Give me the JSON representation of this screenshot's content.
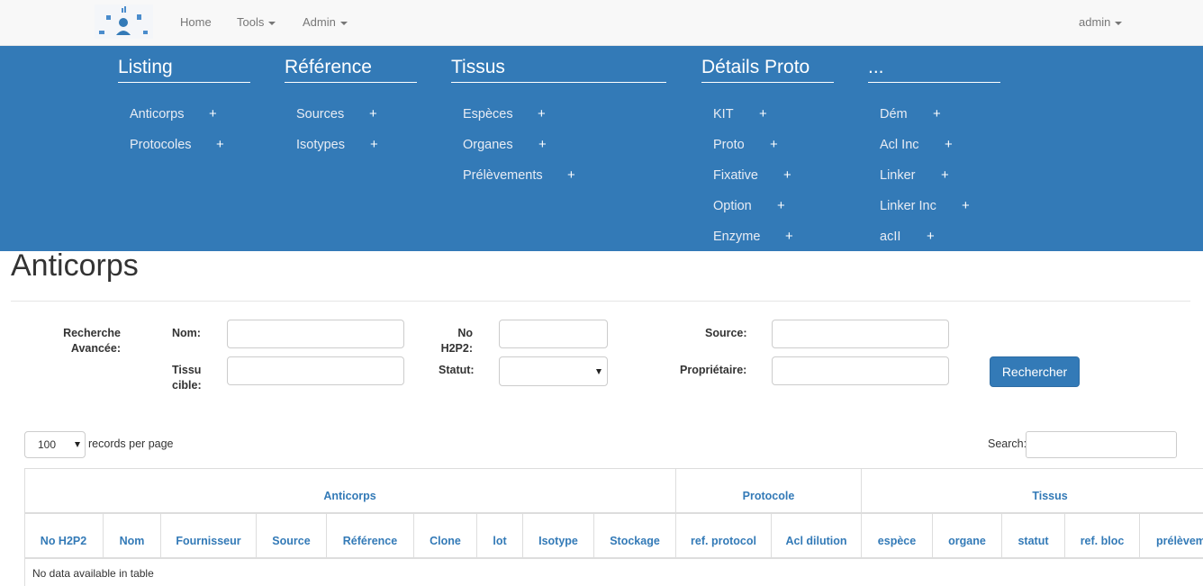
{
  "navbar": {
    "home": "Home",
    "tools": "Tools",
    "admin": "Admin",
    "user": "admin"
  },
  "menu": {
    "listing": {
      "title": "Listing",
      "items": [
        "Anticorps",
        "Protocoles"
      ]
    },
    "reference": {
      "title": "Référence",
      "items": [
        "Sources",
        "Isotypes"
      ]
    },
    "tissus": {
      "title": "Tissus",
      "items": [
        "Espèces",
        "Organes",
        "Prélèvements"
      ]
    },
    "details": {
      "title": "Détails Proto",
      "items": [
        "KIT",
        "Proto",
        "Fixative",
        "Option",
        "Enzyme"
      ]
    },
    "more": {
      "title": "...",
      "items": [
        "Dém",
        "Acl Inc",
        "Linker",
        "Linker Inc",
        "acII"
      ]
    },
    "plus": "+"
  },
  "page": {
    "title": "Anticorps"
  },
  "search_form": {
    "advanced_line1": "Recherche",
    "advanced_line2": "Avancée:",
    "nom": "Nom:",
    "no_line1": "No",
    "no_line2": "H2P2:",
    "source": "Source:",
    "tissu_line1": "Tissu",
    "tissu_line2": "cible:",
    "statut": "Statut:",
    "proprietaire": "Propriétaire:",
    "submit": "Rechercher"
  },
  "table_controls": {
    "page_length": "100",
    "records_per_page": "records per page",
    "search_label": "Search:"
  },
  "table": {
    "groups": [
      "Anticorps",
      "Protocole",
      "Tissus"
    ],
    "columns": [
      "No H2P2",
      "Nom",
      "Fournisseur",
      "Source",
      "Référence",
      "Clone",
      "lot",
      "Isotype",
      "Stockage",
      "ref. protocol",
      "Acl dilution",
      "espèce",
      "organe",
      "statut",
      "ref. bloc",
      "prélèvem"
    ],
    "empty_message": "No data available in table"
  },
  "colors": {
    "primary": "#337ab7",
    "navbar_bg": "#f8f8f8",
    "nav_text": "#777777"
  }
}
